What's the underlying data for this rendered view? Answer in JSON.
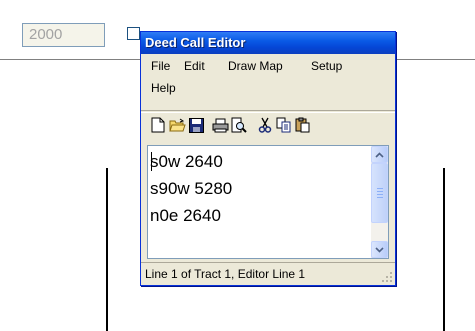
{
  "background": {
    "year_input_value": "2000"
  },
  "window": {
    "title": "Deed Call Editor"
  },
  "menu": {
    "items": [
      "File",
      "Edit",
      "Draw Map",
      "Setup",
      "Help"
    ]
  },
  "toolbar": {
    "buttons": [
      "new-file-icon",
      "open-folder-icon",
      "save-icon",
      "print-icon",
      "print-preview-icon",
      "cut-icon",
      "copy-icon",
      "paste-icon"
    ]
  },
  "editor": {
    "lines": [
      "s0w 2640",
      "s90w 5280",
      "n0e 2640"
    ]
  },
  "statusbar": {
    "text": "Line 1 of Tract 1, Editor Line 1"
  },
  "colors": {
    "titlebar": "#0a5ae6",
    "window_face": "#ece9d8",
    "editor_border": "#7f9db9"
  }
}
